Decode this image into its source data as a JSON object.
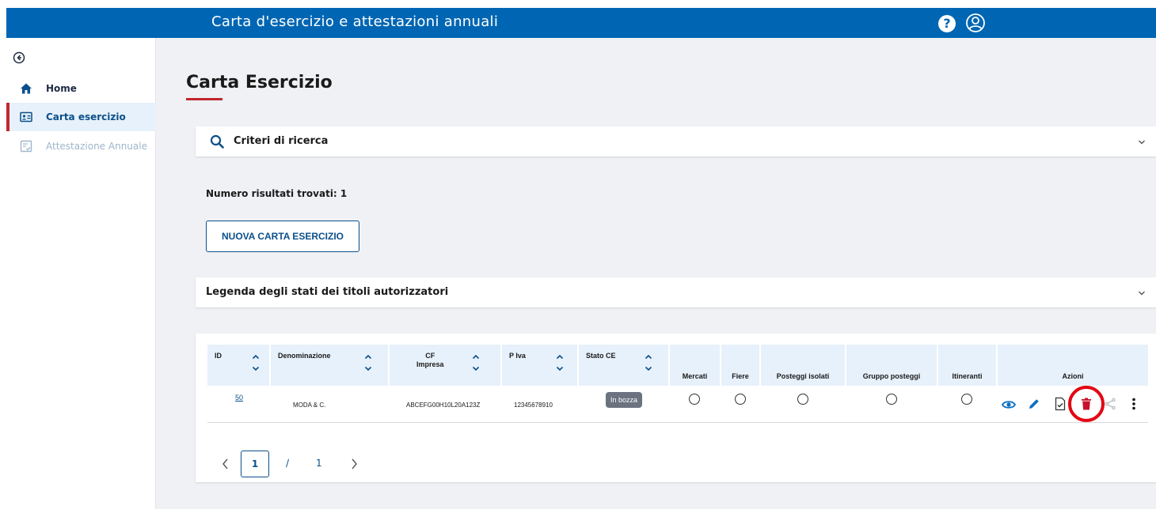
{
  "header": {
    "title": "Carta d'esercizio e attestazioni annuali",
    "help_label": "?"
  },
  "sidebar": {
    "items": [
      {
        "label": "Home"
      },
      {
        "label": "Carta esercizio"
      },
      {
        "label": "Attestazione Annuale"
      }
    ]
  },
  "main": {
    "title": "Carta Esercizio",
    "search_panel_label": "Criteri di ricerca",
    "results_text": "Numero risultati trovati: 1",
    "new_button_label": "NUOVA CARTA ESERCIZIO",
    "legend_panel_label": "Legenda degli stati dei titoli autorizzatori"
  },
  "table": {
    "columns": {
      "id": "ID",
      "denominazione": "Denominazione",
      "cf_line1": "CF",
      "cf_line2": "Impresa",
      "piva": "P Iva",
      "stato": "Stato CE",
      "mercati": "Mercati",
      "fiere": "Fiere",
      "posteggi_isolati": "Posteggi isolati",
      "gruppo_posteggi": "Gruppo posteggi",
      "itineranti": "Itineranti",
      "azioni": "Azioni"
    },
    "rows": [
      {
        "id": "50",
        "denominazione": "MODA & C.",
        "cf": "ABCEFG00H10L20A123Z",
        "piva": "12345678910",
        "stato": "In bozza"
      }
    ]
  },
  "pagination": {
    "current": "1",
    "separator": "/",
    "total": "1"
  },
  "colors": {
    "primary": "#0066b3",
    "accent_red": "#c1272d",
    "delete_red": "#c8102e",
    "highlight_ring": "#e30613"
  },
  "icons": [
    "arrow-left-circle-icon",
    "home-icon",
    "id-card-icon",
    "checklist-icon",
    "search-icon",
    "chevron-down-icon",
    "eye-icon",
    "pencil-icon",
    "document-check-icon",
    "trash-icon",
    "share-icon",
    "more-vertical-icon",
    "help-icon",
    "user-icon"
  ]
}
